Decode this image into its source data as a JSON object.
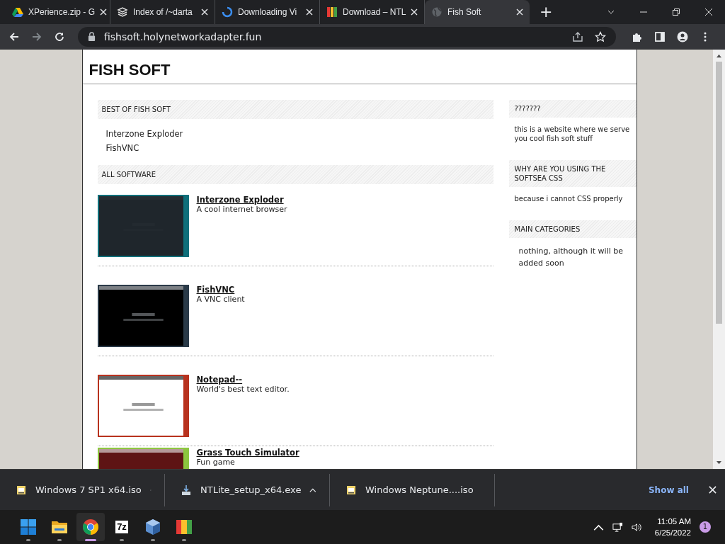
{
  "browser": {
    "tabs": [
      {
        "title": "XPerience.zip - G",
        "kind": "drive",
        "selected": false
      },
      {
        "title": "Index of /~darta",
        "kind": "archive",
        "selected": false
      },
      {
        "title": "Downloading Vi",
        "kind": "spinner",
        "selected": false
      },
      {
        "title": "Download – NTL",
        "kind": "blocks",
        "selected": false
      },
      {
        "title": "Fish Soft",
        "kind": "globe",
        "selected": true
      }
    ],
    "new_tab": "+",
    "address": "fishsoft.holynetworkadapter.fun"
  },
  "page": {
    "site_title": "FISH SOFT",
    "best_of": {
      "heading": "BEST OF FISH SOFT",
      "items": [
        "Interzone Exploder",
        "FishVNC"
      ]
    },
    "all_software": {
      "heading": "ALL SOFTWARE",
      "items": [
        {
          "name": "Interzone Exploder",
          "description": "A cool internet browser",
          "kind": "picture"
        },
        {
          "name": "FishVNC",
          "description": "A VNC client",
          "kind": "picture"
        },
        {
          "name": "Notepad--",
          "description": "World's best text editor.",
          "kind": "picture"
        },
        {
          "name": "Grass Touch Simulator",
          "description": "Fun game",
          "kind": "picture"
        }
      ]
    },
    "sidebar": [
      {
        "heading": "???????",
        "text": "this is a website where we serve you cool fish soft stuff"
      },
      {
        "heading": "WHY ARE YOU USING THE SOFTSEA CSS",
        "text": "because i cannot CSS properly"
      },
      {
        "heading": "MAIN CATEGORIES",
        "text": "nothing, although it will be added soon",
        "indent": true
      }
    ]
  },
  "downloads": {
    "items": [
      {
        "name": "Windows 7 SP1 x64.iso",
        "kind": "disc"
      },
      {
        "name": "NTLite_setup_x64.exe",
        "kind": "installer"
      },
      {
        "name": "Windows Neptune....iso",
        "kind": "disc"
      }
    ],
    "show_all": "Show all"
  },
  "taskbar": {
    "apps": [
      {
        "kind": "start",
        "selected": false
      },
      {
        "kind": "folder",
        "selected": false
      },
      {
        "kind": "chrome",
        "selected": true
      },
      {
        "kind": "sevenzip",
        "label": "7z",
        "selected": false
      },
      {
        "kind": "cube",
        "selected": false
      },
      {
        "kind": "blocks",
        "selected": false
      }
    ],
    "time": "11:05 AM",
    "date": "6/25/2022",
    "notifications": "1"
  }
}
